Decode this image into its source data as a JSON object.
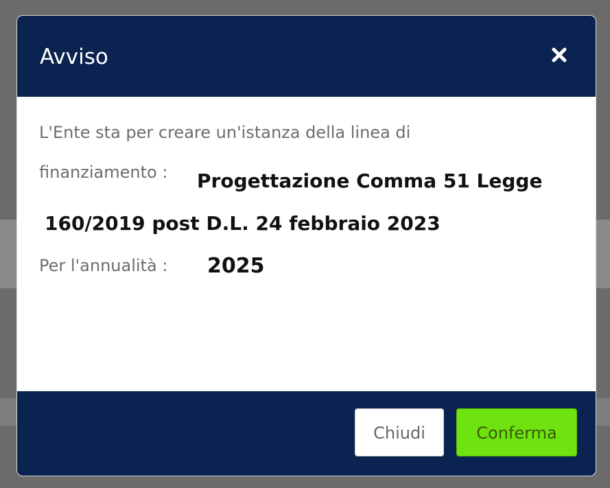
{
  "dialog": {
    "title": "Avviso",
    "close_icon": "close-icon",
    "body": {
      "line1": "L'Ente sta per creare un'istanza della linea di",
      "line2_prefix": "finanziamento :",
      "funding_line_part1": "Progettazione Comma 51 Legge",
      "funding_line_part2": "160/2019 post D.L. 24 febbraio 2023",
      "year_label": "Per l'annualità :",
      "year_value": "2025"
    },
    "footer": {
      "close_label": "Chiudi",
      "confirm_label": "Conferma"
    }
  },
  "colors": {
    "header_bg": "#0b2350",
    "confirm_bg": "#6ee30f"
  }
}
